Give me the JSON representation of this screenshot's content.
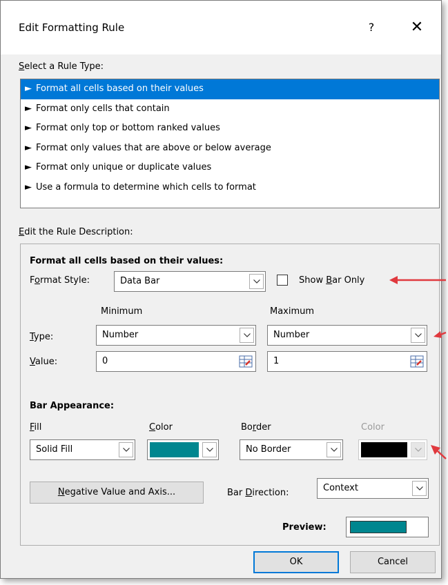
{
  "dialog": {
    "title": "Edit Formatting Rule",
    "help": "?",
    "close": "✕"
  },
  "select_rule": {
    "label_prefix": "S",
    "label_rest": "elect a Rule Type:",
    "items": [
      "Format all cells based on their values",
      "Format only cells that contain",
      "Format only top or bottom ranked values",
      "Format only values that are above or below average",
      "Format only unique or duplicate values",
      "Use a formula to determine which cells to format"
    ],
    "selected_index": 0
  },
  "description": {
    "label_prefix": "E",
    "label_rest": "dit the Rule Description:",
    "heading": "Format all cells based on their values:",
    "format_style_label_a": "F",
    "format_style_label_b": "o",
    "format_style_label_c": "rmat Style:",
    "format_style_value": "Data Bar",
    "show_bar_only_a": "Show ",
    "show_bar_only_b": "B",
    "show_bar_only_c": "ar Only",
    "minimum_header": "Minimum",
    "maximum_header": "Maximum",
    "type_label_a": "T",
    "type_label_b": "ype:",
    "value_label_a": "V",
    "value_label_b": "alue:",
    "min_type": "Number",
    "max_type": "Number",
    "min_value": "0",
    "max_value": "1",
    "bar_appearance": "Bar Appearance:",
    "fill_label_a": "F",
    "fill_label_b": "ill",
    "color_label_a": "C",
    "color_label_b": "olor",
    "border_label_a": "Bo",
    "border_label_b": "r",
    "border_label_c": "der",
    "border_color_label": "Color",
    "fill_value": "Solid Fill",
    "border_value": "No Border",
    "negative_button_a": "N",
    "negative_button_b": "egative Value and Axis...",
    "bar_direction_a": "Bar ",
    "bar_direction_b": "D",
    "bar_direction_c": "irection:",
    "bar_direction_value": "Context",
    "preview_label": "Preview:"
  },
  "buttons": {
    "ok": "OK",
    "cancel": "Cancel"
  },
  "colors": {
    "accent": "#0078d7",
    "fill_color": "#00868f",
    "border_color": "#000000",
    "annotation_arrow": "#e0393e"
  },
  "icons": {
    "bullet": "arrow-bullet-icon",
    "dropdown": "chevron-down-icon",
    "cell_picker": "range-picker-icon"
  }
}
